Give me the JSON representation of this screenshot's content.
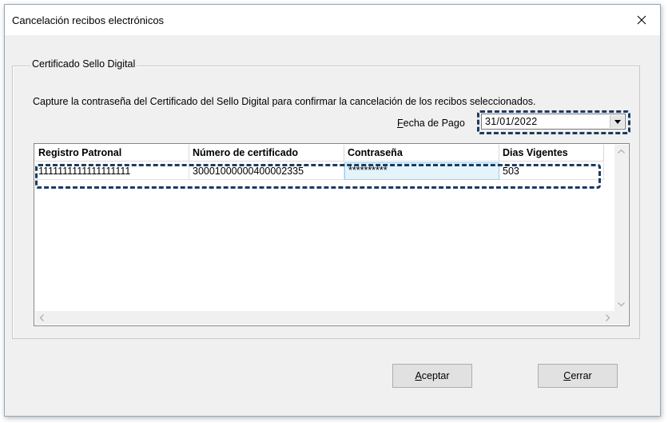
{
  "window": {
    "title": "Cancelación recibos electrónicos"
  },
  "group": {
    "legend": "Certificado Sello Digital",
    "instructions": "Capture la contraseña del Certificado del Sello Digital para confirmar la cancelación de los recibos seleccionados."
  },
  "fecha": {
    "label_mnemonic": "F",
    "label_rest": "echa de Pago",
    "value": "31/01/2022"
  },
  "grid": {
    "columns": [
      "Registro Patronal",
      "Número de certificado",
      "Contraseña",
      "Dias Vigentes"
    ],
    "rows": [
      [
        "1111111111111111111",
        "30001000000400002335",
        "**********",
        "503"
      ]
    ]
  },
  "buttons": {
    "accept_mnemonic": "A",
    "accept_rest": "ceptar",
    "close_mnemonic": "C",
    "close_rest": "errar"
  },
  "icons": {
    "close": "close-icon",
    "dropdown": "chevron-down-icon",
    "scroll_up": "chevron-up-icon",
    "scroll_down": "chevron-down-icon",
    "scroll_left": "chevron-left-icon",
    "scroll_right": "chevron-right-icon"
  },
  "colors": {
    "highlight": "#1d3a5f",
    "selected_cell": "#e5f3fb"
  }
}
